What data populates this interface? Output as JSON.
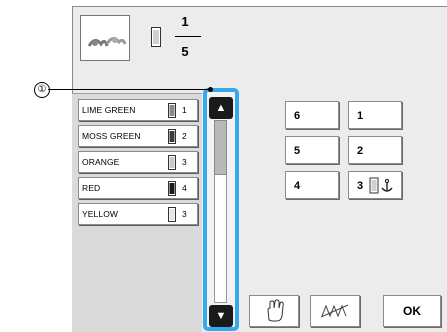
{
  "callout": "①",
  "header": {
    "current": "1",
    "total": "5"
  },
  "thread_list": [
    {
      "name": "LIME GREEN",
      "num": "1",
      "spool_color": "#8a8a8a"
    },
    {
      "name": "MOSS GREEN",
      "num": "2",
      "spool_color": "#3c3c3c"
    },
    {
      "name": "ORANGE",
      "num": "3",
      "spool_color": "#c8c8c8"
    },
    {
      "name": "RED",
      "num": "4",
      "spool_color": "#1a1a1a"
    },
    {
      "name": "YELLOW",
      "num": "3",
      "spool_color": "#e6e6e6"
    }
  ],
  "scroll": {
    "up": "▲",
    "down": "▼"
  },
  "grid": {
    "b6": "6",
    "b1": "1",
    "b5": "5",
    "b2": "2",
    "b4": "4",
    "b3": "3"
  },
  "ok_label": "OK",
  "accent_color": "#39a7ea"
}
